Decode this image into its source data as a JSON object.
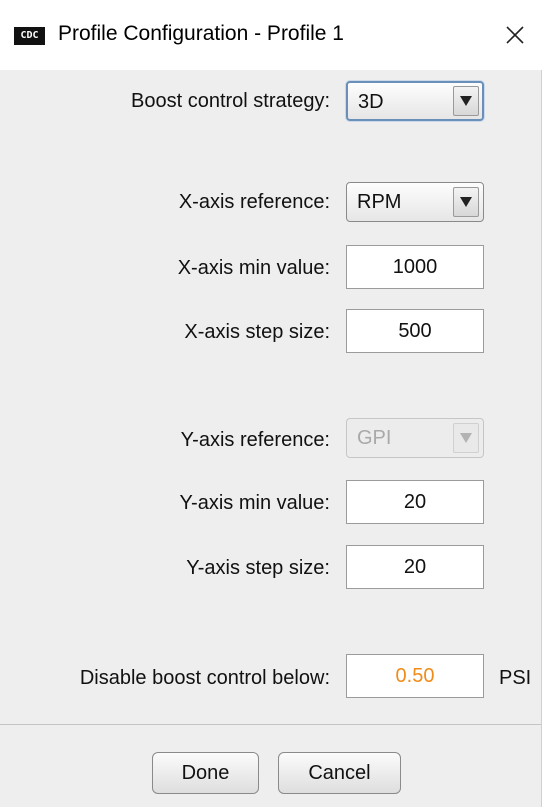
{
  "window": {
    "title": "Profile Configuration - Profile 1",
    "app_icon_text": "CDC"
  },
  "form": {
    "boost_strategy": {
      "label": "Boost control strategy:",
      "value": "3D"
    },
    "x_reference": {
      "label": "X-axis reference:",
      "value": "RPM"
    },
    "x_min": {
      "label": "X-axis min value:",
      "value": "1000"
    },
    "x_step": {
      "label": "X-axis step size:",
      "value": "500"
    },
    "y_reference": {
      "label": "Y-axis reference:",
      "value": "GPI",
      "disabled": true
    },
    "y_min": {
      "label": "Y-axis min value:",
      "value": "20"
    },
    "y_step": {
      "label": "Y-axis step size:",
      "value": "20"
    },
    "disable_below": {
      "label": "Disable boost control below:",
      "value": "0.50",
      "unit": "PSI",
      "value_color": "#f08c1a"
    }
  },
  "buttons": {
    "done": "Done",
    "cancel": "Cancel"
  },
  "icons": {
    "close": "close-icon",
    "dropdown": "triangle-down-icon"
  }
}
